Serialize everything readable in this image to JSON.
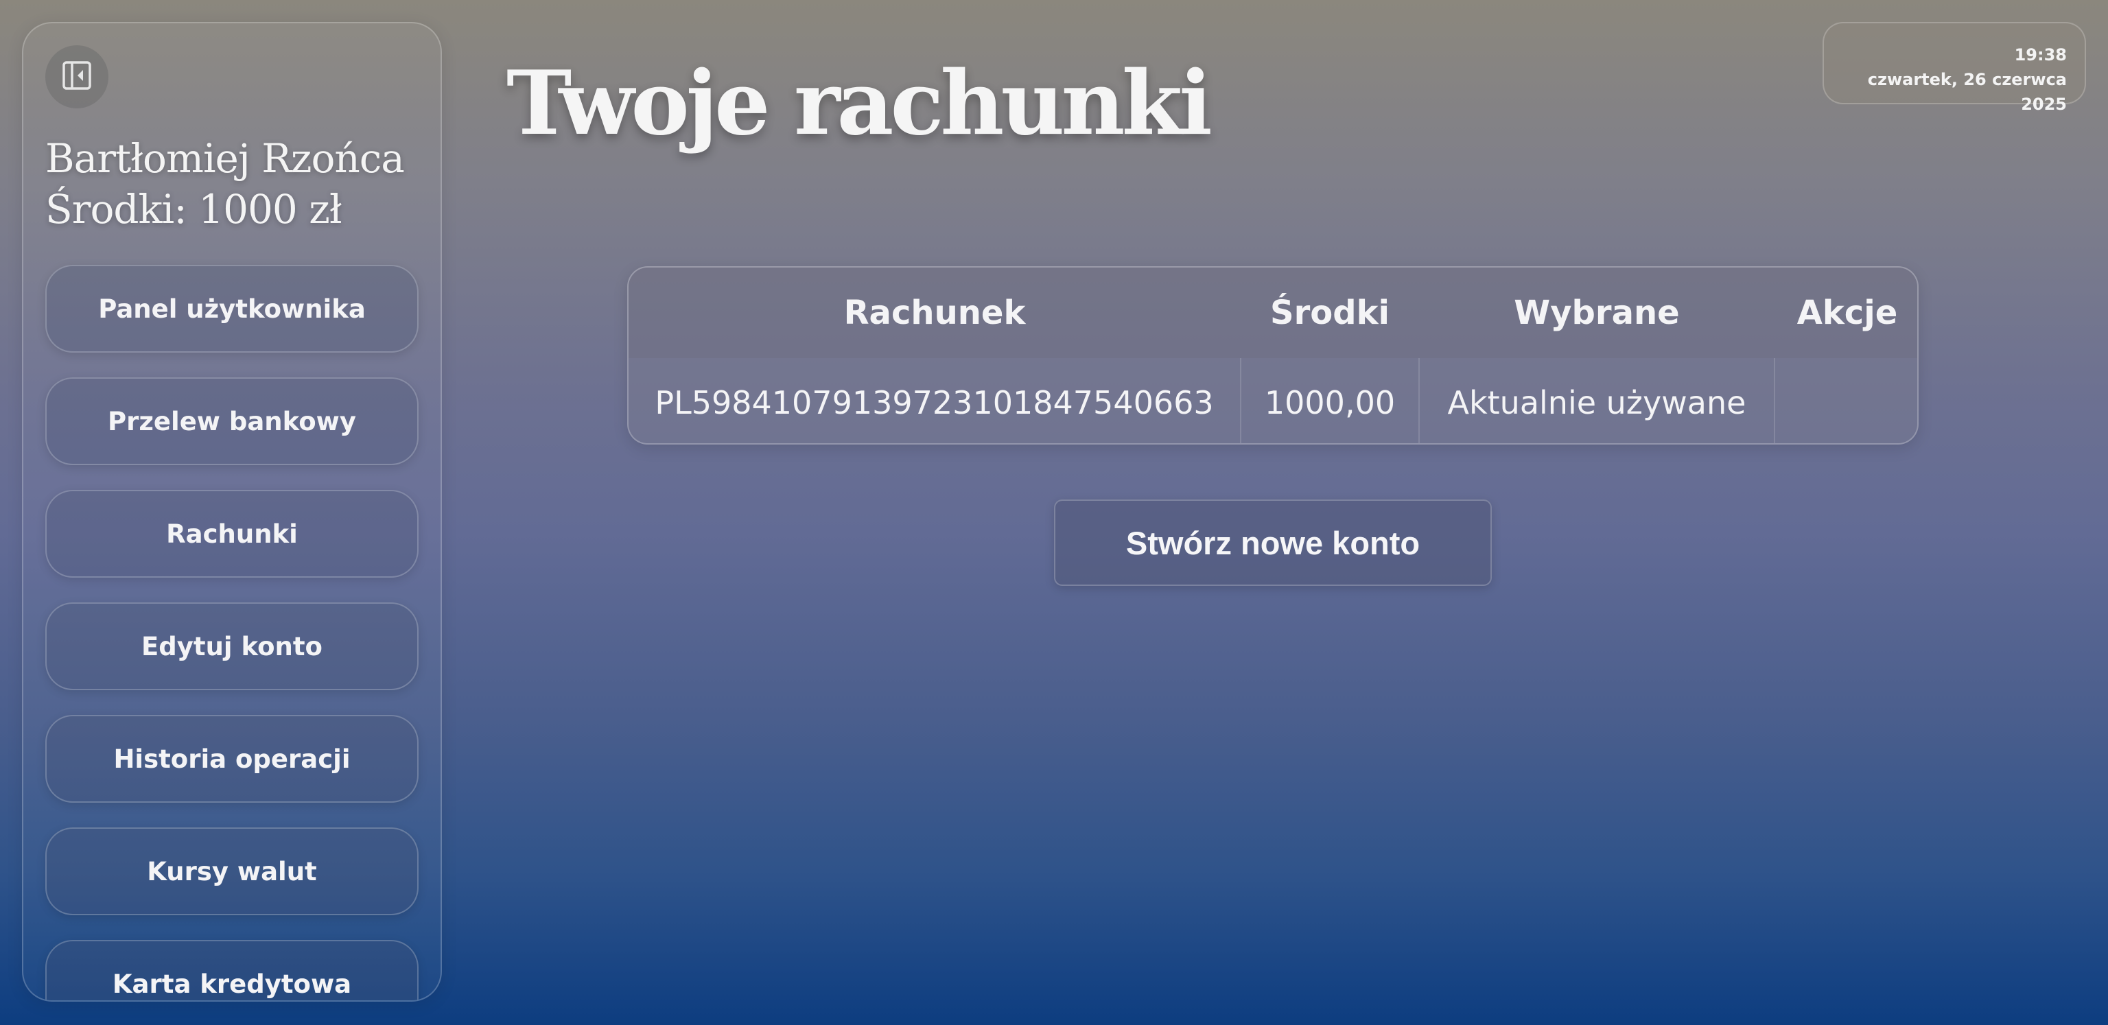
{
  "sidebar": {
    "collapse_icon": "sidebar-collapse-icon",
    "user_name": "Bartłomiej Rzońca",
    "balance": "Środki: 1000 zł",
    "items": [
      {
        "label": "Panel użytkownika"
      },
      {
        "label": "Przelew bankowy"
      },
      {
        "label": "Rachunki"
      },
      {
        "label": "Edytuj konto"
      },
      {
        "label": "Historia operacji"
      },
      {
        "label": "Kursy walut"
      },
      {
        "label": "Karta kredytowa"
      }
    ]
  },
  "header": {
    "title": "Twoje rachunki"
  },
  "clock": {
    "time": "19:38",
    "date": "czwartek, 26 czerwca 2025"
  },
  "accounts_table": {
    "columns": [
      "Rachunek",
      "Środki",
      "Wybrane",
      "Akcje"
    ],
    "rows": [
      {
        "account": "PL59841079139723101847540663",
        "funds": "1000,00",
        "selected": "Aktualnie używane",
        "actions": ""
      }
    ]
  },
  "create_button": {
    "label": "Stwórz nowe konto"
  },
  "colors": {
    "background_top": "#8b877d",
    "background_bottom": "#0d3d80",
    "text": "#f4f4f6"
  }
}
